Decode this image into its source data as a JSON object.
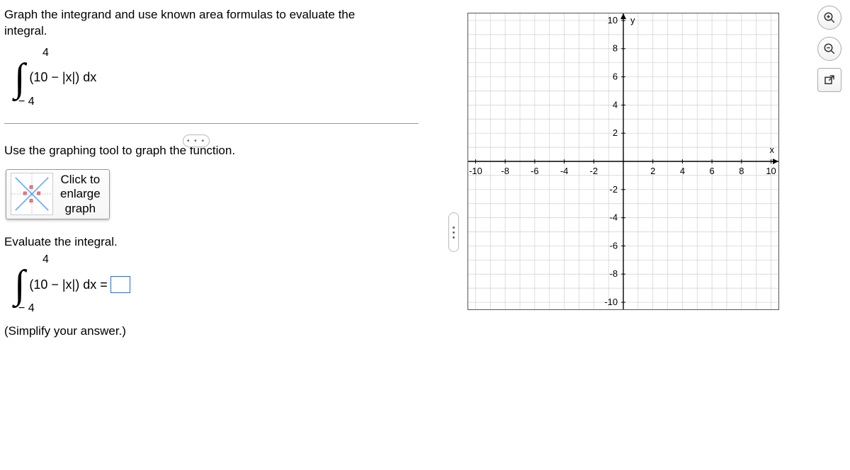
{
  "prompt": {
    "line1": "Graph the integrand and use known area formulas to evaluate the",
    "line2": "integral."
  },
  "integral": {
    "upper": "4",
    "lower": "− 4",
    "expr_left": "(10 − |x|) dx"
  },
  "instruction": "Use the graphing tool to graph the function.",
  "graph_button": {
    "line1": "Click to",
    "line2": "enlarge",
    "line3": "graph"
  },
  "evaluate_label": "Evaluate the integral.",
  "integral2": {
    "upper": "4",
    "lower": "− 4",
    "expr": "(10 − |x|) dx ="
  },
  "simplify": "(Simplify your answer.)",
  "ellipsis": "•  •  •",
  "chart_data": {
    "type": "empty-cartesian-grid",
    "title": "",
    "xlabel": "x",
    "ylabel": "y",
    "x_ticks": [
      -10,
      -8,
      -6,
      -4,
      -2,
      2,
      4,
      6,
      8,
      10
    ],
    "y_ticks": [
      -10,
      -8,
      -6,
      -4,
      -2,
      2,
      4,
      6,
      8,
      10
    ],
    "xlim": [
      -10.5,
      10.5
    ],
    "ylim": [
      -10.5,
      10.5
    ],
    "grid": true,
    "series": []
  },
  "tools": {
    "zoom_in": "zoom-in",
    "zoom_out": "zoom-out",
    "open_external": "open-external"
  }
}
